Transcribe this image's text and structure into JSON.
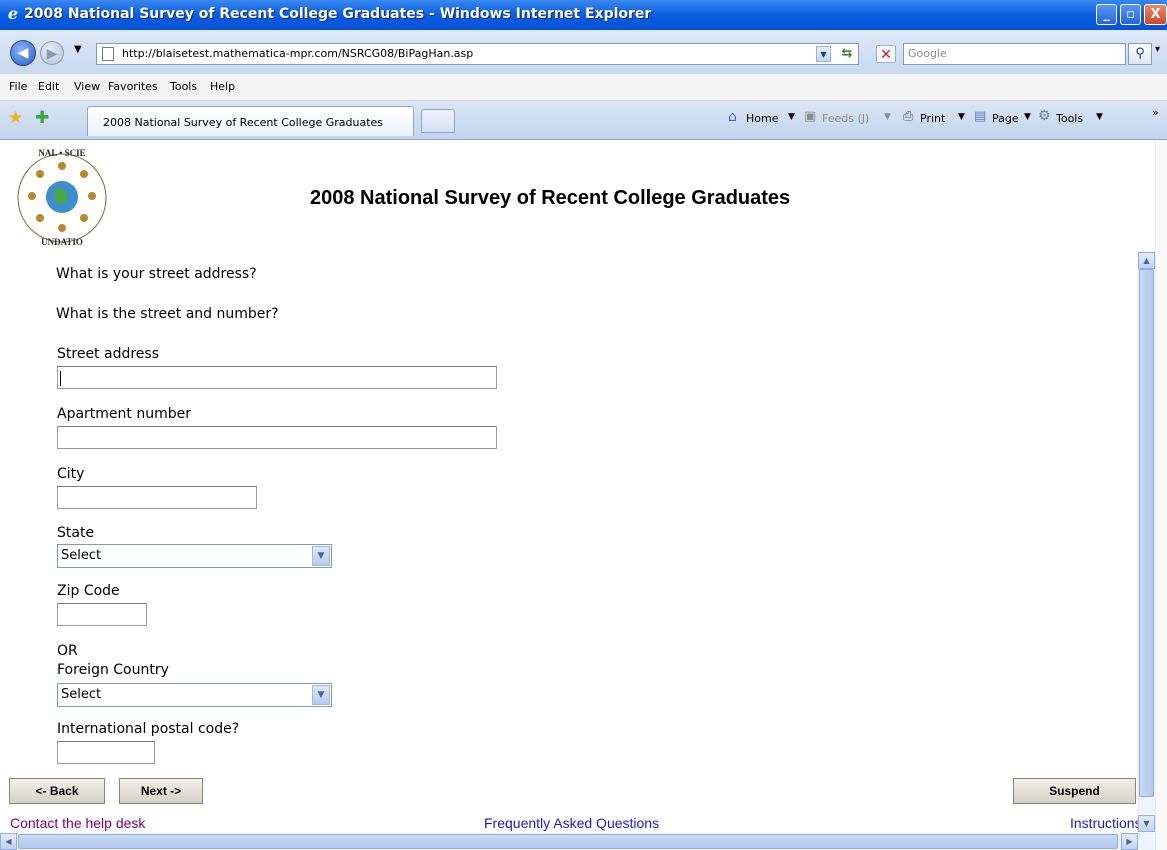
{
  "window": {
    "title": "2008 National Survey of Recent College Graduates - Windows Internet Explorer",
    "minimize": "_",
    "maximize": "▫",
    "close": "X"
  },
  "addressbar": {
    "url": "http://blaisetest.mathematica-mpr.com/NSRCG08/BiPagHan.asp",
    "search_placeholder": "Google"
  },
  "menu": [
    "File",
    "Edit",
    "View",
    "Favorites",
    "Tools",
    "Help"
  ],
  "tabs": {
    "active_label": "2008 National Survey of Recent College Graduates"
  },
  "commandbar": {
    "home": "Home",
    "feeds": "Feeds (J)",
    "print": "Print",
    "page": "Page",
    "tools": "Tools",
    "more": "»"
  },
  "page": {
    "title": "2008 National Survey of Recent College Graduates",
    "question": "What is your street address?",
    "subquestion": "What is the street and number?",
    "fields": {
      "street_label": "Street address",
      "street_value": "",
      "apt_label": "Apartment number",
      "apt_value": "",
      "city_label": "City",
      "city_value": "",
      "state_label": "State",
      "state_selected": "Select",
      "zip_label": "Zip Code",
      "zip_value": "",
      "or_label": "OR",
      "country_label": "Foreign Country",
      "country_selected": "Select",
      "intl_label": "International postal code?",
      "intl_value": ""
    },
    "buttons": {
      "back": "<- Back",
      "next": "Next ->",
      "suspend": "Suspend"
    },
    "footer": {
      "help": "Contact the help desk",
      "faq": "Frequently Asked Questions",
      "instructions": "Instructions"
    }
  },
  "icons": [
    "ie-logo-icon",
    "back-arrow-icon",
    "forward-arrow-icon",
    "refresh-icon",
    "stop-icon",
    "search-icon",
    "favorites-star-icon",
    "add-favorites-icon",
    "home-icon",
    "feeds-icon",
    "print-icon",
    "page-icon",
    "tools-gear-icon",
    "nsf-logo",
    "dropdown-arrow-icon"
  ]
}
